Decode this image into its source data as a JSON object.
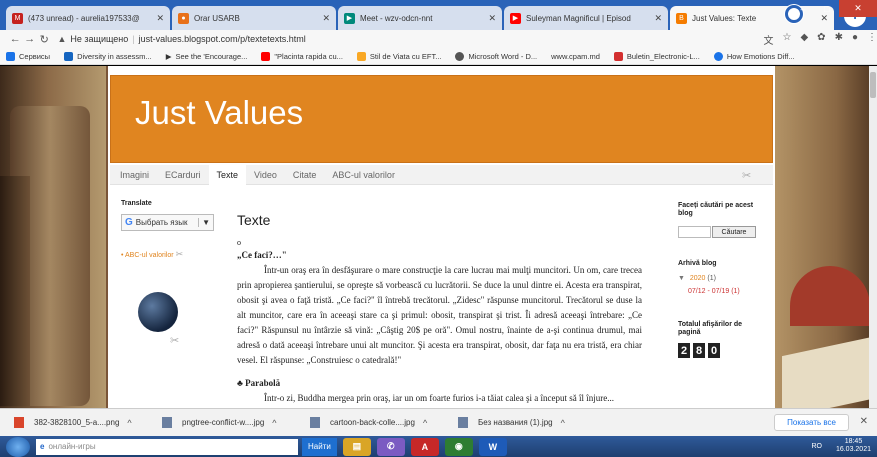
{
  "browser": {
    "tabs": [
      {
        "title": "(473 unread) - aurelia197533@",
        "icon_color": "#c5221f",
        "icon": "mail-icon",
        "active": false
      },
      {
        "title": "Orar USARB",
        "icon_color": "#e8711a",
        "icon": "orar-icon",
        "active": false
      },
      {
        "title": "Meet - wzv-odcn-nnt",
        "icon_color": "#00897b",
        "icon": "meet-icon",
        "active": false
      },
      {
        "title": "Suleyman Magnificul | Episod",
        "icon_color": "#ff0000",
        "icon": "youtube-icon",
        "active": false
      },
      {
        "title": "Just Values: Texte",
        "icon_color": "#f57c00",
        "icon": "blogger-icon",
        "active": true
      }
    ],
    "new_tab": "+",
    "address": {
      "security": "Не защищено",
      "url": "just-values.blogspot.com/p/textetexts.html"
    },
    "bookmarks": [
      {
        "label": "Сервисы",
        "color": "#1a73e8"
      },
      {
        "label": "Diversity in assessm...",
        "color": "#1565c0"
      },
      {
        "label": "See the 'Encourage...",
        "color": "#444"
      },
      {
        "label": "\"Placinta rapida cu...",
        "color": "#ff0000"
      },
      {
        "label": "Stil de Viata cu EFT...",
        "color": "#f9a825"
      },
      {
        "label": "Microsoft Word - D...",
        "color": "#555"
      },
      {
        "label": "www.cpam.md",
        "color": "#fff"
      },
      {
        "label": "Buletin_Electronic-L...",
        "color": "#d32f2f"
      },
      {
        "label": "How Emotions Diff...",
        "color": "#1a73e8"
      }
    ]
  },
  "blog": {
    "title": "Just Values",
    "tabs": [
      "Imagini",
      "ECarduri",
      "Texte",
      "Video",
      "Citate",
      "ABC-ul valorilor"
    ],
    "active_tab": "Texte",
    "translate_title": "Translate",
    "translate_select": "Выбрать язык",
    "sidebar_link": "ABC-ul valorilor",
    "post_title": "Texte",
    "post_bullet": "o",
    "section1_title": "„Ce faci?…\"",
    "section1_text": "Într-un oraş era în desfăşurare o mare construcţie la care lucrau mai mulţi muncitori. Un om, care trecea prin apropierea şantierului, se opreşte să vorbească cu lucrătorii. Se duce la unul dintre ei. Acesta era transpirat, obosit şi avea o faţă tristă. „Ce faci?\" îl întrebă trecătorul. „Zidesc\" răspunse muncitorul. Trecătorul se duse la alt muncitor, care era în aceeaşi stare ca şi primul: obosit, transpirat şi trist. Îi adresă aceeaşi întrebare: „Ce faci?\" Răspunsul nu întârzie să vină: „Câştig 20$ pe oră\". Omul nostru, înainte de a-şi continua drumul, mai adresă o dată aceeaşi întrebare unui alt muncitor. Şi acesta era transpirat, obosit, dar faţa nu era tristă, era chiar vesel. El răspunse: „Construiesc o catedrală!\"",
    "section2_title": "Parabolă",
    "section2_text": "Într-o zi, Buddha mergea prin oraş, iar un om foarte furios i-a tăiat calea şi a început să îl înjure...",
    "search_label": "Faceți căutări pe acest blog",
    "search_button": "Căutare",
    "archive_label": "Arhivă blog",
    "archive_year": "2020",
    "archive_year_count": "(1)",
    "archive_month": "07/12 - 07/19 (1)",
    "views_label": "Totalul afişărilor de pagină",
    "views_digits": [
      "2",
      "8",
      "0"
    ]
  },
  "downloads": {
    "files": [
      {
        "name": "382-3828100_5-a....png",
        "type": "pdf"
      },
      {
        "name": "pngtree-conflict-w....jpg",
        "type": "img"
      },
      {
        "name": "cartoon-back-colle....jpg",
        "type": "img"
      },
      {
        "name": "Без названия (1).jpg",
        "type": "img"
      }
    ],
    "show_all": "Показать все"
  },
  "taskbar": {
    "search_placeholder": "онлайн-игры",
    "search_button": "Найти",
    "lang": "RO",
    "time": "18:45",
    "date": "16.03.2021"
  }
}
